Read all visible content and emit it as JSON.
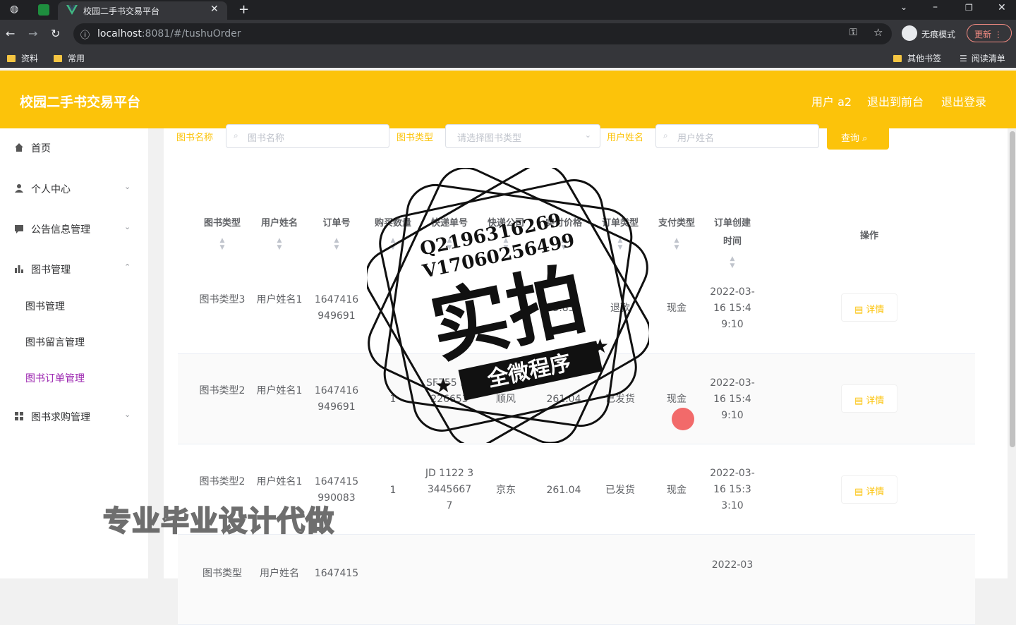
{
  "browser": {
    "tab_title": "校园二手书交易平台",
    "url_host": "localhost",
    "url_rest": ":8081/#/tushuOrder",
    "incognito_label": "无痕模式",
    "update_label": "更新",
    "bookmarks": [
      "资料",
      "常用"
    ],
    "bookmarks_right": [
      "其他书签",
      "阅读清单"
    ]
  },
  "header": {
    "title": "校园二手书交易平台",
    "user": "用户 a2",
    "to_front": "退出到前台",
    "logout": "退出登录"
  },
  "sidebar": {
    "items": [
      {
        "label": "首页",
        "icon": "home-icon"
      },
      {
        "label": "个人中心",
        "icon": "user-icon"
      },
      {
        "label": "公告信息管理",
        "icon": "message-icon"
      },
      {
        "label": "图书管理",
        "icon": "chart-icon"
      }
    ],
    "sub_items": [
      "图书管理",
      "图书留言管理",
      "图书订单管理"
    ],
    "last_item": {
      "label": "图书求购管理",
      "icon": "grid-icon"
    },
    "active_color": "#9c27b0"
  },
  "filters": {
    "book_name_label": "图书名称",
    "book_name_placeholder": "图书名称",
    "book_type_label": "图书类型",
    "book_type_placeholder": "请选择图书类型",
    "user_name_label": "用户姓名",
    "user_name_placeholder": "用户姓名",
    "search_label": "查询"
  },
  "table": {
    "headers": [
      "图书类型",
      "用户姓名",
      "订单号",
      "购买数量",
      "快递单号",
      "快递公司",
      "实付价格",
      "订单类型",
      "支付类型",
      "订单创建时间",
      "操作"
    ],
    "rows": [
      {
        "type": "图书类型3",
        "user": "用户姓名1",
        "order": "1647416949691",
        "qty": "",
        "express_no": "",
        "company": "",
        "price": "5.83",
        "order_type": "退款",
        "pay": "现金",
        "time": "2022-03-16 15:49:10"
      },
      {
        "type": "图书类型2",
        "user": "用户姓名1",
        "order": "1647416949691",
        "qty": "1",
        "express_no": "SF755 99226653",
        "company": "顺风",
        "price": "261.04",
        "order_type": "已发货",
        "pay": "现金",
        "time": "2022-03-16 15:49:10"
      },
      {
        "type": "图书类型2",
        "user": "用户姓名1",
        "order": "1647415990083",
        "qty": "1",
        "express_no": "JD 1122 334456677",
        "company": "京东",
        "price": "261.04",
        "order_type": "已发货",
        "pay": "现金",
        "time": "2022-03-16 15:33:10"
      },
      {
        "type": "图书类型",
        "user": "用户姓名",
        "order": "1647415",
        "qty": "",
        "express_no": "",
        "company": "",
        "price": "",
        "order_type": "",
        "pay": "",
        "time": "2022-03"
      }
    ],
    "detail_label": "详情"
  },
  "overlay": {
    "stamp_line1": "Q2196316269",
    "stamp_line2": "V17060256499",
    "stamp_main": "实拍",
    "stamp_banner": "全微程序",
    "watermark": "专业毕业设计代做"
  },
  "accent_color": "#fcc30a"
}
